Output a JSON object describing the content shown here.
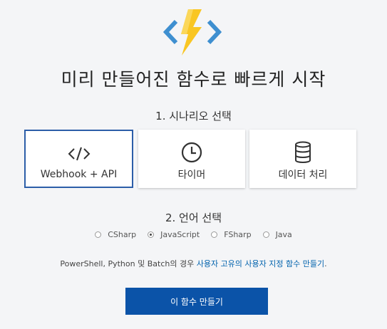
{
  "page": {
    "title": "미리 만들어진 함수로 빠르게 시작",
    "background": "#f4f5f7"
  },
  "logo": {
    "icon": "azure-functions-bolt-icon",
    "bracket_color": "#3e8fd0",
    "bolt_color": "#f9c623"
  },
  "step1": {
    "title": "1. 시나리오 선택",
    "cards": [
      {
        "label": "Webhook + API",
        "icon": "code-brackets-icon",
        "selected": true
      },
      {
        "label": "타이머",
        "icon": "clock-icon",
        "selected": false
      },
      {
        "label": "데이터 처리",
        "icon": "database-icon",
        "selected": false
      }
    ],
    "selected_border_color": "#2c5ea8"
  },
  "step2": {
    "title": "2. 언어 선택",
    "languages": [
      {
        "label": "CSharp",
        "checked": false
      },
      {
        "label": "JavaScript",
        "checked": true
      },
      {
        "label": "FSharp",
        "checked": false
      },
      {
        "label": "Java",
        "checked": false
      }
    ]
  },
  "note": {
    "prefix": "PowerShell, Python 및 Batch의 경우 ",
    "link": "사용자 고유의 사용자 지정 함수 만들기",
    "suffix": "."
  },
  "create_button": {
    "label": "이 함수 만들기",
    "color": "#0b53a8"
  }
}
